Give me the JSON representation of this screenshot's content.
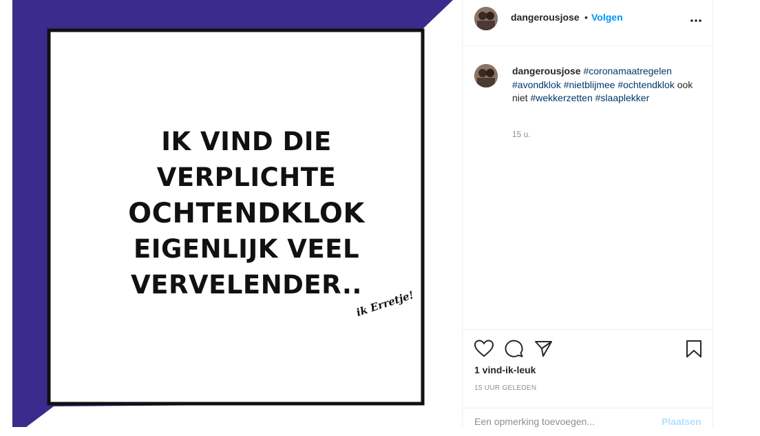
{
  "post": {
    "image": {
      "quote_lines": [
        "IK VIND DIE",
        "VERPLICHTE",
        "OCHTENDKLOK",
        "EIGENLIJK VEEL",
        "VERVELENDER.."
      ],
      "brand_mark": "ik Erretje!",
      "colors": {
        "background_band": "#3a2b8c",
        "card": "#ffffff",
        "text": "#111111"
      }
    },
    "header": {
      "username": "dangerousjose",
      "separator": "•",
      "follow_label": "Volgen",
      "more_icon": "more-horizontal-icon"
    },
    "caption": {
      "username": "dangerousjose",
      "tag1": "#coronamaatregelen",
      "tag2": "#avondklok",
      "tag3": "#nietblijmee",
      "tag4": "#ochtendklok",
      "plain": " ook niet ",
      "tag5": "#wekkerzetten",
      "tag6": "#slaaplekker",
      "time": "15 u."
    },
    "actions": {
      "icons": [
        "heart-icon",
        "comment-icon",
        "share-icon",
        "bookmark-icon"
      ],
      "likes": "1 vind-ik-leuk",
      "timestamp": "15 UUR GELEDEN"
    },
    "comment": {
      "placeholder": "Een opmerking toevoegen...",
      "post_label": "Plaatsen"
    },
    "colors": {
      "link": "#0095f6",
      "hashtag": "#00376b",
      "muted": "#8e8e8e",
      "disabled_link": "#b2dffc"
    }
  }
}
